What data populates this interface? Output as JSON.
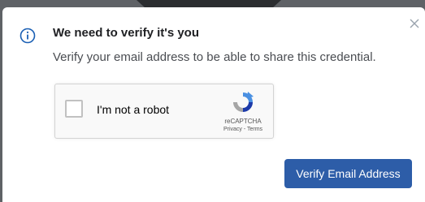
{
  "dialog": {
    "title": "We need to verify it's you",
    "message": "Verify your email address to be able to share this credential.",
    "close_icon": "close-icon",
    "info_icon": "info-icon"
  },
  "captcha": {
    "label": "I'm not a robot",
    "brand": "reCAPTCHA",
    "links": "Privacy - Terms",
    "checked": false,
    "logo_icon": "recaptcha-logo-icon"
  },
  "actions": {
    "verify_label": "Verify Email Address"
  },
  "colors": {
    "primary": "#2d5da8",
    "info_icon": "#1a5fb4",
    "overlay": "#5f6266"
  }
}
